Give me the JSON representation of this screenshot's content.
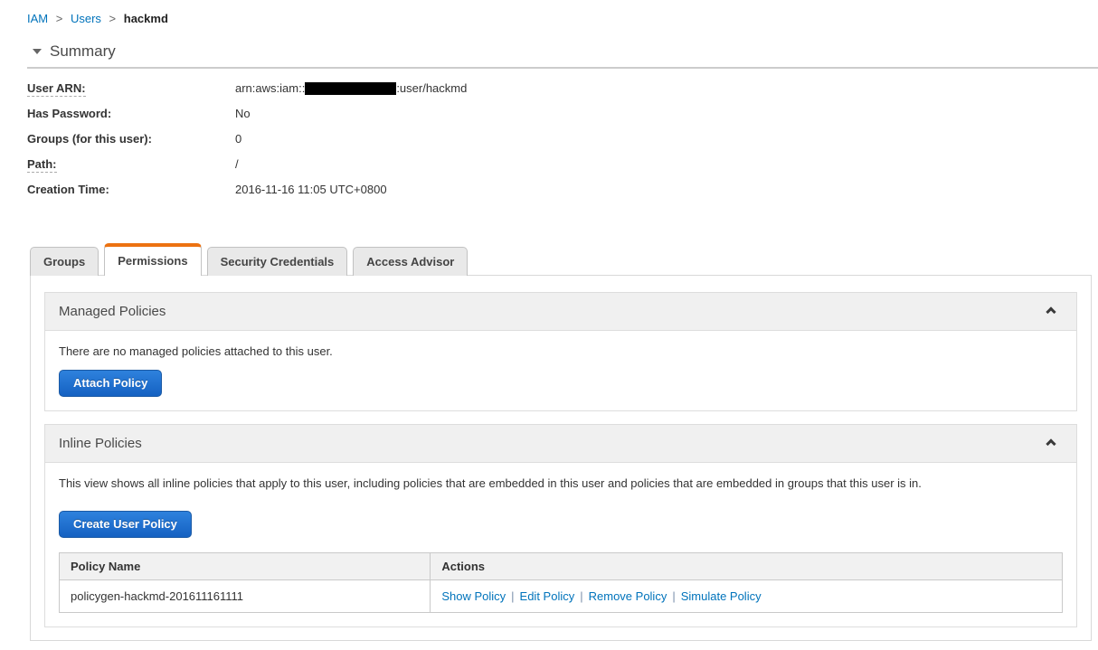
{
  "breadcrumb": {
    "separator": ">",
    "items": [
      {
        "label": "IAM"
      },
      {
        "label": "Users"
      },
      {
        "label": "hackmd"
      }
    ]
  },
  "summary": {
    "title": "Summary",
    "fields": [
      {
        "label": "User ARN:",
        "value_prefix": "arn:aws:iam::",
        "value_redacted": true,
        "value_suffix": ":user/hackmd"
      },
      {
        "label": "Has Password:",
        "value": "No"
      },
      {
        "label": "Groups (for this user):",
        "value": "0"
      },
      {
        "label": "Path:",
        "value": "/"
      },
      {
        "label": "Creation Time:",
        "value": "2016-11-16 11:05 UTC+0800"
      }
    ]
  },
  "tabs": [
    {
      "label": "Groups",
      "active": false
    },
    {
      "label": "Permissions",
      "active": true
    },
    {
      "label": "Security Credentials",
      "active": false
    },
    {
      "label": "Access Advisor",
      "active": false
    }
  ],
  "managed_policies": {
    "title": "Managed Policies",
    "empty_text": "There are no managed policies attached to this user.",
    "attach_button": "Attach Policy"
  },
  "inline_policies": {
    "title": "Inline Policies",
    "description": "This view shows all inline policies that apply to this user, including policies that are embedded in this user and policies that are embedded in groups that this user is in.",
    "create_button": "Create User Policy",
    "actions_separator": "|",
    "table": {
      "headers": [
        "Policy Name",
        "Actions"
      ],
      "rows": [
        {
          "policy_name": "policygen-hackmd-201611161111",
          "actions": [
            "Show Policy",
            "Edit Policy",
            "Remove Policy",
            "Simulate Policy"
          ]
        }
      ]
    }
  },
  "colors": {
    "accent_orange": "#ec7211",
    "link_blue": "#0073bb",
    "button_blue_top": "#2e82dd",
    "button_blue_bottom": "#1561c2",
    "panel_header_bg": "#f0f0f0"
  }
}
